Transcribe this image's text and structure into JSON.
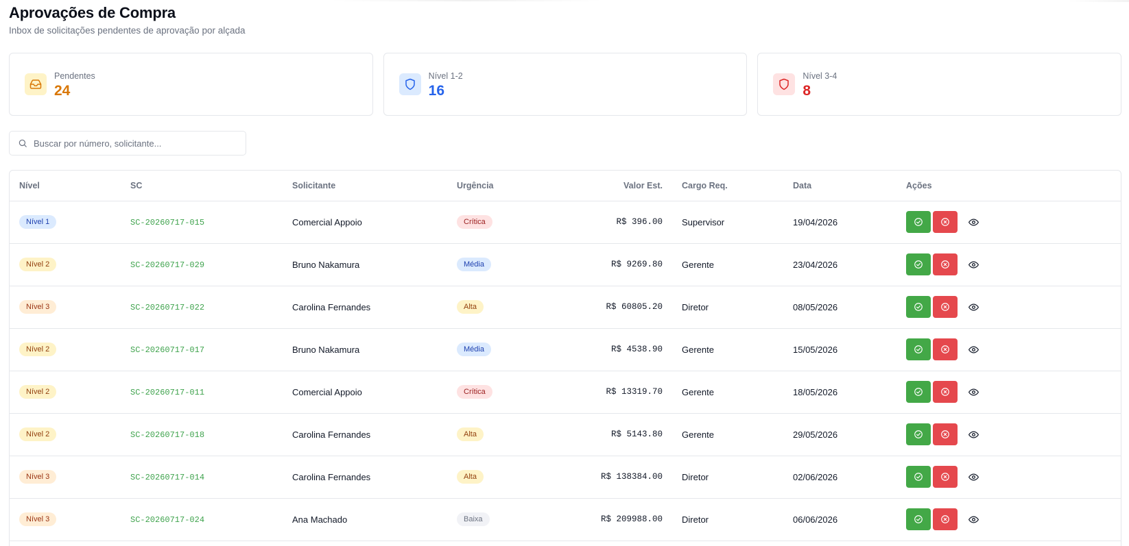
{
  "header": {
    "title": "Aprovações de Compra",
    "subtitle": "Inbox de solicitações pendentes de aprovação por alçada"
  },
  "cards": [
    {
      "label": "Pendentes",
      "value": "24",
      "icon": "inbox-icon",
      "color": "#d97706",
      "bg": "#fef3c7"
    },
    {
      "label": "Nível 1-2",
      "value": "16",
      "icon": "shield-icon",
      "color": "#2563eb",
      "bg": "#dbeafe"
    },
    {
      "label": "Nível 3-4",
      "value": "8",
      "icon": "shield-icon",
      "color": "#dc2626",
      "bg": "#fee2e2"
    }
  ],
  "search": {
    "placeholder": "Buscar por número, solicitante..."
  },
  "table": {
    "columns": [
      "Nível",
      "SC",
      "Solicitante",
      "Urgência",
      "Valor Est.",
      "Cargo Req.",
      "Data",
      "Ações"
    ],
    "rows": [
      {
        "nivel": "Nível 1",
        "sc": "SC-20260717-015",
        "solicitante": "Comercial Appoio",
        "urgencia": "Crítica",
        "valor": "R$ 396.00",
        "cargo": "Supervisor",
        "data": "19/04/2026"
      },
      {
        "nivel": "Nível 2",
        "sc": "SC-20260717-029",
        "solicitante": "Bruno Nakamura",
        "urgencia": "Média",
        "valor": "R$ 9269.80",
        "cargo": "Gerente",
        "data": "23/04/2026"
      },
      {
        "nivel": "Nível 3",
        "sc": "SC-20260717-022",
        "solicitante": "Carolina Fernandes",
        "urgencia": "Alta",
        "valor": "R$ 60805.20",
        "cargo": "Diretor",
        "data": "08/05/2026"
      },
      {
        "nivel": "Nível 2",
        "sc": "SC-20260717-017",
        "solicitante": "Bruno Nakamura",
        "urgencia": "Média",
        "valor": "R$ 4538.90",
        "cargo": "Gerente",
        "data": "15/05/2026"
      },
      {
        "nivel": "Nível 2",
        "sc": "SC-20260717-011",
        "solicitante": "Comercial Appoio",
        "urgencia": "Crítica",
        "valor": "R$ 13319.70",
        "cargo": "Gerente",
        "data": "18/05/2026"
      },
      {
        "nivel": "Nível 2",
        "sc": "SC-20260717-018",
        "solicitante": "Carolina Fernandes",
        "urgencia": "Alta",
        "valor": "R$ 5143.80",
        "cargo": "Gerente",
        "data": "29/05/2026"
      },
      {
        "nivel": "Nível 3",
        "sc": "SC-20260717-014",
        "solicitante": "Carolina Fernandes",
        "urgencia": "Alta",
        "valor": "R$ 138384.00",
        "cargo": "Diretor",
        "data": "02/06/2026"
      },
      {
        "nivel": "Nível 3",
        "sc": "SC-20260717-024",
        "solicitante": "Ana Machado",
        "urgencia": "Baixa",
        "valor": "R$ 209988.00",
        "cargo": "Diretor",
        "data": "06/06/2026"
      }
    ],
    "action_icons": {
      "approve": "check-circle-icon",
      "reject": "x-circle-icon",
      "view": "eye-icon"
    }
  },
  "colors": {
    "approve": "#43a847",
    "reject": "#e5484d",
    "sc_link": "#3fa34d",
    "border": "#e5e7eb"
  }
}
